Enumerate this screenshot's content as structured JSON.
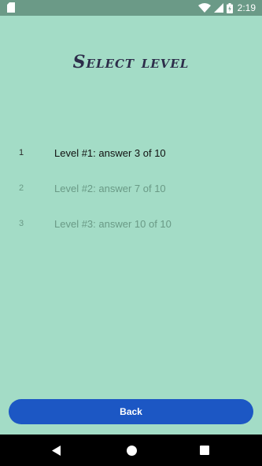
{
  "status_bar": {
    "time": "2:19",
    "icons": [
      "sd-card-icon",
      "wifi-icon",
      "signal-icon",
      "battery-charging-icon"
    ]
  },
  "page": {
    "title": "Select level"
  },
  "levels": [
    {
      "number": "1",
      "label": "Level #1: answer 3 of 10",
      "state": "unlocked"
    },
    {
      "number": "2",
      "label": "Level #2: answer 7 of 10",
      "state": "locked"
    },
    {
      "number": "3",
      "label": "Level #3: answer 10 of 10",
      "state": "locked"
    }
  ],
  "footer": {
    "back_label": "Back"
  },
  "nav_bar": {
    "icons": [
      "back-triangle-icon",
      "home-circle-icon",
      "recents-square-icon"
    ]
  },
  "colors": {
    "background": "#a3dcc6",
    "status_bar": "#6b9a87",
    "title": "#2d2d4a",
    "accent_button": "#1c57c4",
    "locked_text": "#6a9a86"
  }
}
